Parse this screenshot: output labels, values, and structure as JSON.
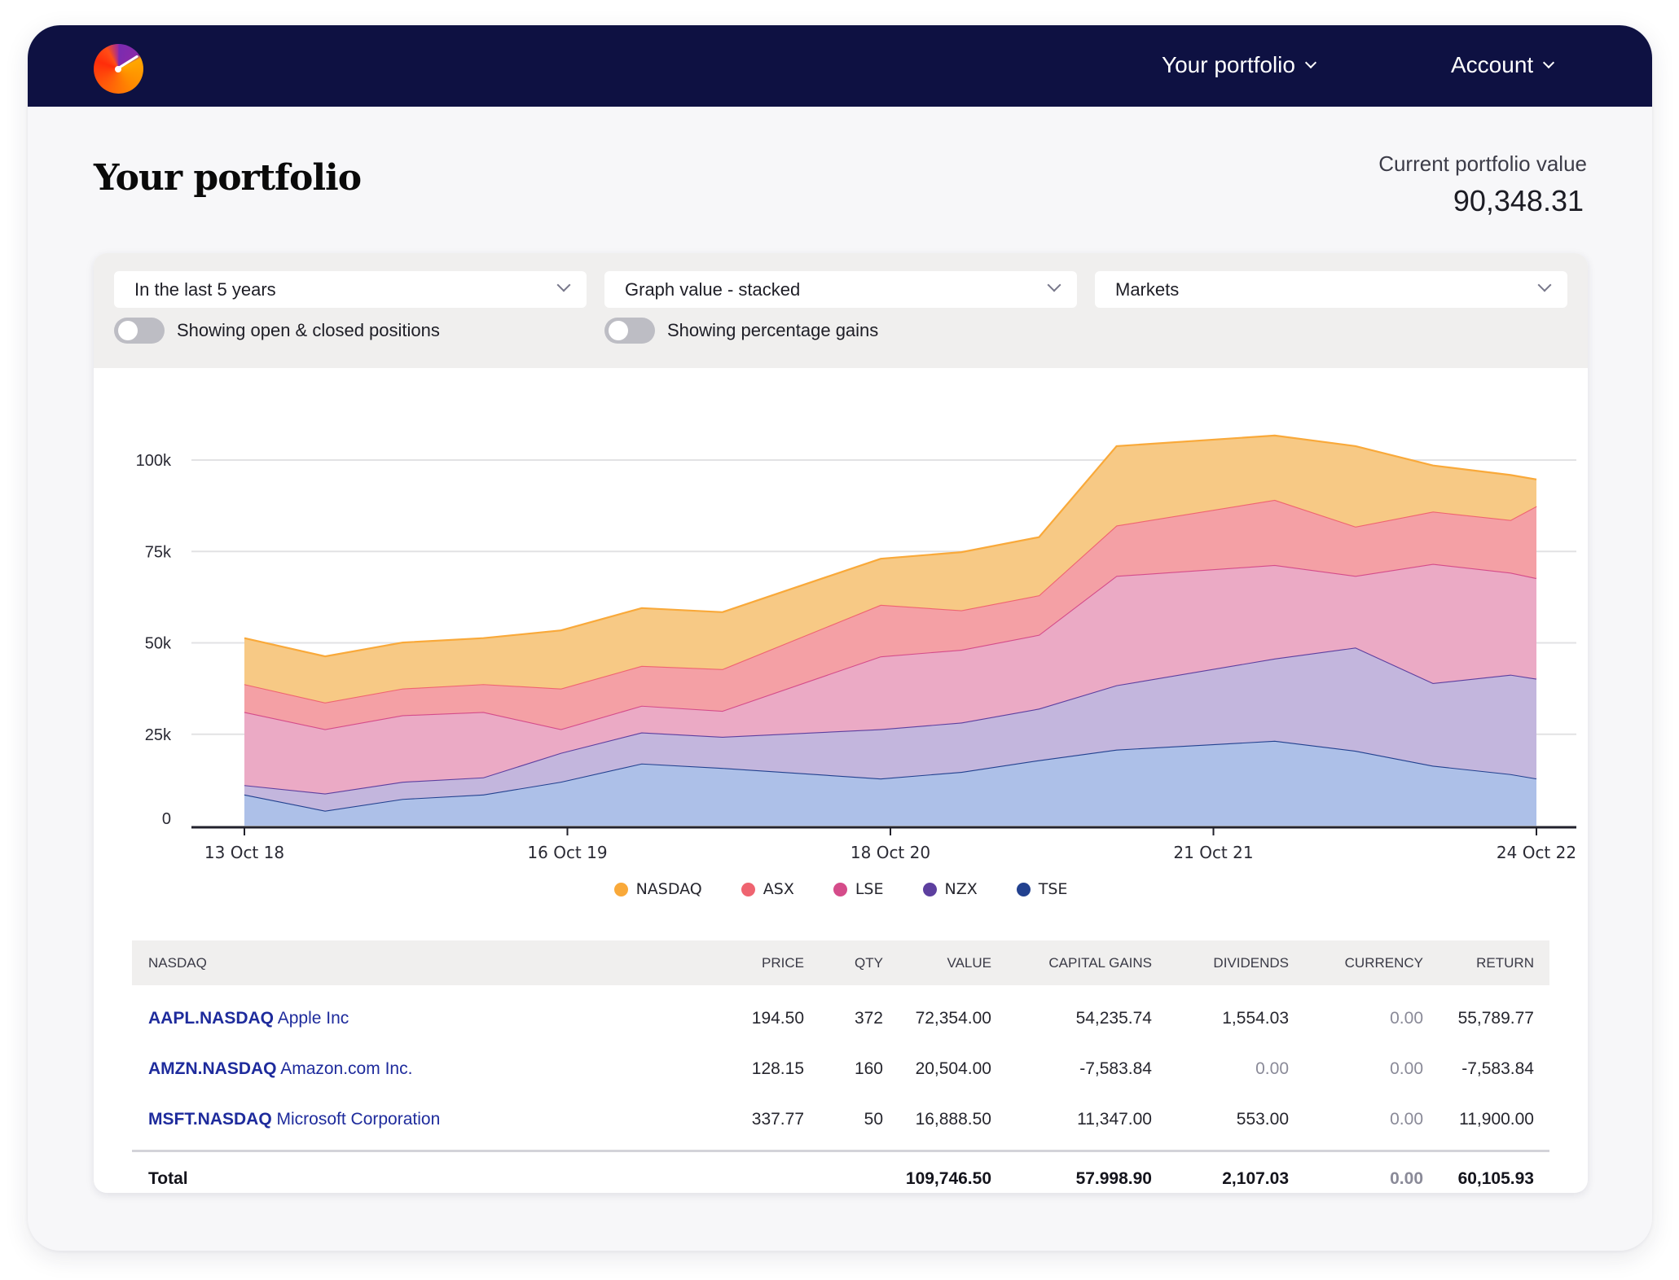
{
  "header": {
    "logo": "gauge-logo",
    "nav": [
      {
        "label": "Your portfolio",
        "icon": "chevron-down-icon"
      },
      {
        "label": "Account",
        "icon": "chevron-down-icon"
      }
    ]
  },
  "page": {
    "title": "Your portfolio",
    "portfolio_value_label": "Current portfolio value",
    "portfolio_value": "90,348.31"
  },
  "filters": {
    "period": "In the last 5 years",
    "graph_mode": "Graph value - stacked",
    "grouping": "Markets",
    "toggle_positions": {
      "label": "Showing open & closed positions",
      "on": false
    },
    "toggle_percentage": {
      "label": "Showing percentage gains",
      "on": false
    }
  },
  "colors": {
    "nav_bg": "#0e1142",
    "link": "#1e2b9c",
    "NASDAQ": "#f9a93a",
    "ASX": "#ef6470",
    "LSE": "#d54c8a",
    "NZX": "#5d3f9f",
    "TSE": "#22418f"
  },
  "chart_data": {
    "type": "area",
    "stacked": true,
    "ylim": [
      0,
      110000
    ],
    "yticks": [
      0,
      25000,
      50000,
      75000,
      100000
    ],
    "ytick_labels": [
      "0",
      "25k",
      "50k",
      "75k",
      "100k"
    ],
    "xtick_labels": [
      "13 Oct 18",
      "16 Oct 19",
      "18 Oct 20",
      "21 Oct 21",
      "24 Oct 22"
    ],
    "xtick_positions": [
      0,
      1.0,
      2.0,
      3.0,
      4.0
    ],
    "x": [
      0,
      0.25,
      0.49,
      0.74,
      0.98,
      1.23,
      1.48,
      1.97,
      2.22,
      2.46,
      2.7,
      3.19,
      3.44,
      3.68,
      3.92,
      4.0
    ],
    "grid": true,
    "legend": "bottom-center",
    "series": [
      {
        "name": "TSE",
        "values": [
          8.5,
          4.1,
          7.3,
          8.5,
          12.0,
          17.0,
          15.8,
          12.9,
          14.7,
          17.9,
          20.8,
          23.2,
          20.5,
          16.4,
          14.1,
          12.9
        ]
      },
      {
        "name": "NZX",
        "values": [
          2.6,
          4.7,
          4.7,
          4.7,
          7.9,
          8.5,
          8.5,
          13.5,
          13.5,
          14.1,
          17.6,
          22.5,
          28.2,
          22.6,
          27.2,
          27.3
        ]
      },
      {
        "name": "LSE",
        "values": [
          20.0,
          17.6,
          18.2,
          17.9,
          6.5,
          7.3,
          7.1,
          19.9,
          19.9,
          20.2,
          29.9,
          25.6,
          19.6,
          32.6,
          27.9,
          27.5
        ]
      },
      {
        "name": "ASX",
        "values": [
          7.6,
          7.3,
          7.3,
          7.6,
          11.1,
          10.9,
          11.4,
          14.1,
          10.8,
          10.8,
          13.8,
          17.8,
          13.5,
          14.3,
          14.4,
          19.7
        ]
      },
      {
        "name": "NASDAQ",
        "values": [
          12.6,
          12.6,
          12.6,
          12.6,
          15.9,
          15.8,
          15.6,
          12.6,
          15.9,
          15.9,
          21.7,
          17.6,
          22.0,
          12.6,
          12.3,
          7.3
        ]
      }
    ],
    "value_unit": "thousands"
  },
  "legend": [
    "NASDAQ",
    "ASX",
    "LSE",
    "NZX",
    "TSE"
  ],
  "table": {
    "group": "NASDAQ",
    "columns": [
      "PRICE",
      "QTY",
      "VALUE",
      "CAPITAL GAINS",
      "DIVIDENDS",
      "CURRENCY",
      "RETURN"
    ],
    "rows": [
      {
        "ticker": "AAPL.NASDAQ",
        "company": "Apple Inc",
        "price": "194.50",
        "qty": "372",
        "value": "72,354.00",
        "capital_gains": "54,235.74",
        "dividends": "1,554.03",
        "currency": "0.00",
        "return": "55,789.77"
      },
      {
        "ticker": "AMZN.NASDAQ",
        "company": "Amazon.com Inc.",
        "price": "128.15",
        "qty": "160",
        "value": "20,504.00",
        "capital_gains": "-7,583.84",
        "dividends": "0.00",
        "currency": "0.00",
        "return": "-7,583.84"
      },
      {
        "ticker": "MSFT.NASDAQ",
        "company": "Microsoft Corporation",
        "price": "337.77",
        "qty": "50",
        "value": "16,888.50",
        "capital_gains": "11,347.00",
        "dividends": "553.00",
        "currency": "0.00",
        "return": "11,900.00"
      }
    ],
    "total": {
      "label": "Total",
      "value": "109,746.50",
      "capital_gains": "57.998.90",
      "dividends": "2,107.03",
      "currency": "0.00",
      "return": "60,105.93"
    }
  }
}
